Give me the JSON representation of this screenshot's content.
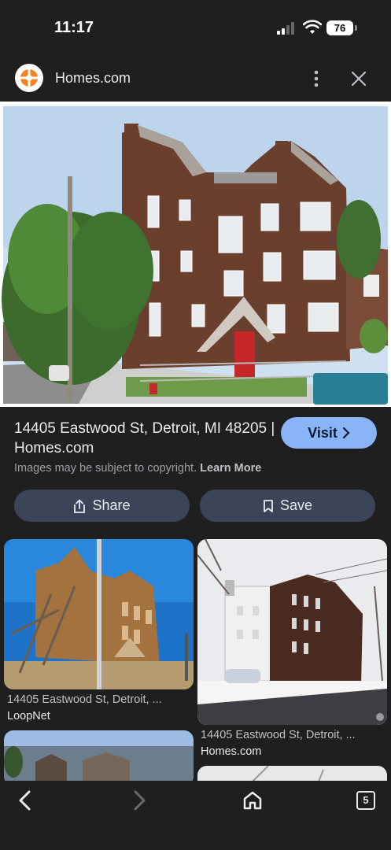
{
  "status_bar": {
    "time": "11:17",
    "battery": "76"
  },
  "source": {
    "name": "Homes.com"
  },
  "result": {
    "title": "14405 Eastwood St, Detroit, MI 48205 | Homes.com",
    "visit_label": "Visit",
    "copyright_text": "Images may be subject to copyright.",
    "learn_more": "Learn More"
  },
  "actions": {
    "share_label": "Share",
    "save_label": "Save"
  },
  "related": [
    {
      "caption": "14405 Eastwood St, Detroit, ...",
      "site": "LoopNet"
    },
    {
      "caption": "14405 Eastwood St, Detroit, ...",
      "site": "Homes.com"
    }
  ],
  "bottom_nav": {
    "tab_count": "5"
  },
  "icons": [
    "more-vert-icon",
    "close-icon",
    "share-icon",
    "bookmark-icon",
    "chevron-right-icon",
    "back-icon",
    "forward-icon",
    "home-icon",
    "tabs-icon"
  ],
  "colors": {
    "background": "#1f1f1f",
    "accent": "#8ab4f8",
    "button": "#3c4457"
  }
}
